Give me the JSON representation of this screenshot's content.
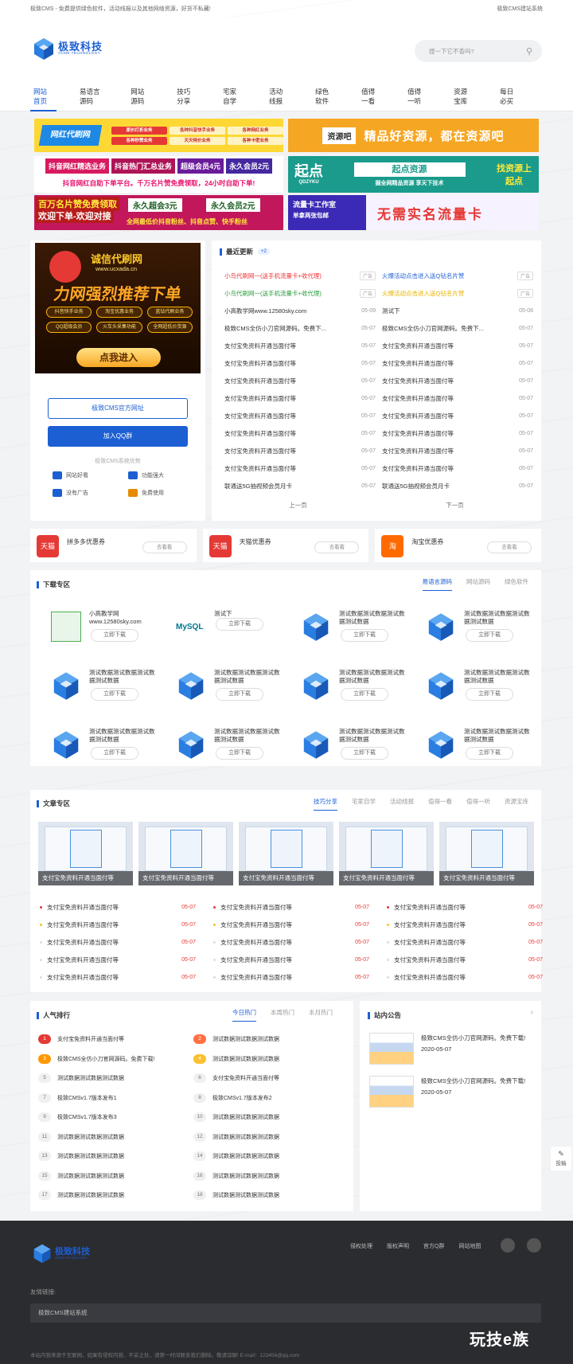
{
  "topbar": {
    "left": "极致CMS - 免费提供绿色软件，活动线报以及其他网络资源，好货不私藏!",
    "right": "极致CMS建站系统"
  },
  "logo": {
    "cn": "极致科技",
    "en": "ACME TECHNOLOGY"
  },
  "search": {
    "placeholder": "搜一下它不香吗?"
  },
  "nav": [
    "网站首页",
    "易语言源码",
    "网站源码",
    "技巧分享",
    "宅家自学",
    "活动线报",
    "绿色软件",
    "值得一看",
    "值得一听",
    "资源宝库",
    "每日必买"
  ],
  "ads": {
    "a1": "网红代刷网",
    "a1b": [
      "原价打折业务",
      "各种抖音快手业务",
      "各种网红业务",
      "各种秒赞业务",
      "天天特价业务",
      "各种卡密业务"
    ],
    "a2": "精品好资源，都在资源吧",
    "a2logo": "资源吧",
    "a3": [
      "抖音网红精选业务",
      "抖音热门汇总业务",
      "超级会员4元",
      "永久会员2元"
    ],
    "a4": "抖音网红自助下单平台。千万名片赞免费领取，24小时自助下单!",
    "a5logo": "起点",
    "a5sub": "QDZYKU",
    "a5title": "起点资源",
    "a5slogan": "找资源上起点",
    "a5desc": "掘全网精品资源 享天下技术",
    "a6": [
      "百万名片赞免费领取",
      "欢迎下单-欢迎对接",
      "永久超会3元",
      "永久会员2元",
      "全网最低价抖音粉丝、抖音点赞、快手粉丝"
    ],
    "a7": "流量卡工作室",
    "a7sub": "单拿两张包邮",
    "a7b": "无需实名流量卡"
  },
  "promo": {
    "site": "诚信代刷网",
    "url": "www.ucxada.cn",
    "headline": "力网强烈推荐下单",
    "items": [
      "抖音快手业务",
      "淘宝优惠业务",
      "蓝钻代刷业务",
      "QQ超级会员",
      "火车头采集功能",
      "全网超低价货源"
    ],
    "cta": "点我进入"
  },
  "side": {
    "btn1": "极致CMS官方网址",
    "btn2": "加入QQ群",
    "advantage_title": "极致CMS系统优势",
    "features": [
      "网站好看",
      "功能强大",
      "没有广告",
      "免费使用"
    ]
  },
  "updates": {
    "title": "最近更新",
    "badge": "+2",
    "left": [
      {
        "t": "小鸟代刷网一(送手机流量卡+收代理)",
        "d": "广告",
        "ad": true,
        "color": "#e33"
      },
      {
        "t": "小鸟代刷网一(送手机流量卡+收代理)",
        "d": "广告",
        "ad": true,
        "color": "#2a9d3c"
      },
      {
        "t": "小高教学网www.12580sky.com",
        "d": "05-09"
      },
      {
        "t": "极致CMS全仿小刀官网源码。免费下...",
        "d": "05-07"
      },
      {
        "t": "支付宝免资料开通当面付等",
        "d": "05-07"
      },
      {
        "t": "支付宝免资料开通当面付等",
        "d": "05-07"
      },
      {
        "t": "支付宝免资料开通当面付等",
        "d": "05-07"
      },
      {
        "t": "支付宝免资料开通当面付等",
        "d": "05-07"
      },
      {
        "t": "支付宝免资料开通当面付等",
        "d": "05-07"
      },
      {
        "t": "支付宝免资料开通当面付等",
        "d": "05-07"
      },
      {
        "t": "支付宝免资料开通当面付等",
        "d": "05-07"
      },
      {
        "t": "支付宝免资料开通当面付等",
        "d": "05-07"
      },
      {
        "t": "联通送5G抽视频会员月卡",
        "d": "05-07"
      }
    ],
    "right": [
      {
        "t": "火爆活动点击进入送Q钻名片赞",
        "d": "广告",
        "ad": true,
        "color": "#1c5fd3"
      },
      {
        "t": "火爆活动点击进入送Q钻名片赞",
        "d": "广告",
        "ad": true,
        "color": "#e8b400"
      },
      {
        "t": "测试下",
        "d": "05-08"
      },
      {
        "t": "极致CMS全仿小刀官网源码。免费下...",
        "d": "05-07"
      },
      {
        "t": "支付宝免资料开通当面付等",
        "d": "05-07"
      },
      {
        "t": "支付宝免资料开通当面付等",
        "d": "05-07"
      },
      {
        "t": "支付宝免资料开通当面付等",
        "d": "05-07"
      },
      {
        "t": "支付宝免资料开通当面付等",
        "d": "05-07"
      },
      {
        "t": "支付宝免资料开通当面付等",
        "d": "05-07"
      },
      {
        "t": "支付宝免资料开通当面付等",
        "d": "05-07"
      },
      {
        "t": "支付宝免资料开通当面付等",
        "d": "05-07"
      },
      {
        "t": "支付宝免资料开通当面付等",
        "d": "05-07"
      },
      {
        "t": "联通送5G抽视频会员月卡",
        "d": "05-07"
      }
    ],
    "prev": "上一页",
    "next": "下一页"
  },
  "coupons": [
    {
      "icon": "天猫",
      "label": "拼多多优惠券",
      "btn": "去看看"
    },
    {
      "icon": "天猫",
      "label": "天猫优惠券",
      "btn": "去看看"
    },
    {
      "icon": "淘",
      "label": "淘宝优惠券",
      "btn": "去看看"
    }
  ],
  "downloads": {
    "title": "下载专区",
    "tabs": [
      "易语言源码",
      "网站源码",
      "绿色软件"
    ],
    "btn": "立即下载",
    "items": [
      "小高教学网\nwww.12580sky.com",
      "测试下",
      "测试数据测试数据测试数据测试数据",
      "测试数据测试数据测试数据测试数据",
      "测试数据测试数据测试数据测试数据",
      "测试数据测试数据测试数据测试数据",
      "测试数据测试数据测试数据测试数据",
      "测试数据测试数据测试数据测试数据",
      "测试数据测试数据测试数据测试数据",
      "测试数据测试数据测试数据测试数据",
      "测试数据测试数据测试数据测试数据",
      "测试数据测试数据测试数据测试数据"
    ],
    "mysql": "MySQL"
  },
  "articles": {
    "title": "文章专区",
    "tabs": [
      "技巧分享",
      "宅家自学",
      "活动线报",
      "值得一看",
      "值得一听",
      "资源宝库"
    ],
    "thumb_cap": "支付宝免资料开通当面付等",
    "item": "支付宝免资料开通当面付等",
    "date": "05-07"
  },
  "ranking": {
    "title": "人气排行",
    "tabs": [
      "今日热门",
      "本周热门",
      "本月热门"
    ],
    "items": [
      "支付宝免资料开通当面付等",
      "测试数据测试数据测试数据",
      "极致CMS全仿小刀官网源码。免费下载!",
      "测试数据测试数据测试数据",
      "测试数据测试数据测试数据",
      "支付宝免资料开通当面付等",
      "极致CMSv1.7版本发布1",
      "极致CMSv1.7版本发布2",
      "极致CMSv1.7版本发布3",
      "测试数据测试数据测试数据",
      "测试数据测试数据测试数据",
      "测试数据测试数据测试数据",
      "测试数据测试数据测试数据",
      "测试数据测试数据测试数据",
      "测试数据测试数据测试数据",
      "测试数据测试数据测试数据",
      "测试数据测试数据测试数据",
      "测试数据测试数据测试数据"
    ]
  },
  "notice": {
    "title": "站内公告",
    "items": [
      {
        "t": "极致CMS全仿小刀官网源码。免费下载!",
        "d": "2020-05-07"
      },
      {
        "t": "极致CMS全仿小刀官网源码。免费下载!",
        "d": "2020-05-07"
      }
    ]
  },
  "float": {
    "label": "投稿"
  },
  "footer": {
    "links": [
      "侵权处理",
      "版权声明",
      "官方Q群",
      "网站地图"
    ],
    "friend_title": "友情链接:",
    "friend": "极致CMS建站系统",
    "copyright": "本站内容来源于互联网，如果有侵权内容、不妥之处，请第一时间联系我们删除。敬请谅解! E-mail：123456@qq.com",
    "brand": "玩技e族"
  },
  "colors": {
    "accent": "#1c5fd3",
    "footer": "#2b2c30"
  }
}
